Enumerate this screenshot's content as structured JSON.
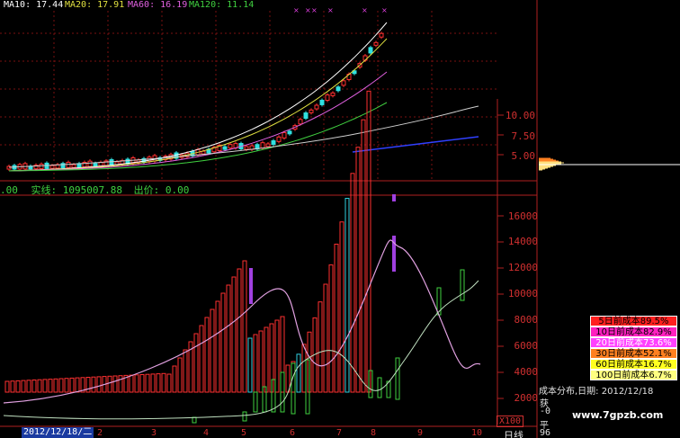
{
  "ma_bar": {
    "ma10": "MA10: 17.44",
    "ma20": "MA20: 17.91",
    "ma60": "MA60: 16.19",
    "ma120": "MA120: 11.14",
    "colors": {
      "ma10": "#ffffff",
      "ma20": "#e0e040",
      "ma60": "#e060e0",
      "ma120": "#40d040"
    }
  },
  "indicator_bar": {
    "left_value": ".00",
    "shiji": "实线: 1095007.88",
    "chujia": "出价: 0.00",
    "color": "#40d040"
  },
  "price_axis": {
    "ticks": [
      "10.00",
      "7.50",
      "5.00"
    ]
  },
  "volume_axis": {
    "ticks": [
      "16000",
      "14000",
      "12000",
      "10000",
      "8000",
      "6000",
      "4000",
      "2000"
    ],
    "unit": "X100"
  },
  "cost_distribution": {
    "items": [
      {
        "label": "5日前成本89.5%",
        "bg": "#ff2020",
        "fg": "#000000"
      },
      {
        "label": "10日前成本82.9%",
        "bg": "#ff20c0",
        "fg": "#000000"
      },
      {
        "label": "20日前成本73.6%",
        "bg": "#ff40ff",
        "fg": "#ffffff"
      },
      {
        "label": "30日前成本52.1%",
        "bg": "#ff8020",
        "fg": "#000000"
      },
      {
        "label": "60日前成本16.7%",
        "bg": "#ffff20",
        "fg": "#000000"
      },
      {
        "label": "100日前成本6.7%",
        "bg": "#ffff80",
        "fg": "#000000"
      }
    ],
    "title": "成本分布,日期: 2012/12/18",
    "row_huo": "获",
    "row_zero": "-0",
    "row_ping": "平",
    "row_96": "96"
  },
  "time_axis": {
    "date_label": "2012/12/18/二",
    "ticks": [
      "2",
      "3",
      "4",
      "5",
      "6",
      "7",
      "8",
      "9",
      "10"
    ],
    "period_label": "日线"
  },
  "watermark": "www.7gpzb.com"
}
